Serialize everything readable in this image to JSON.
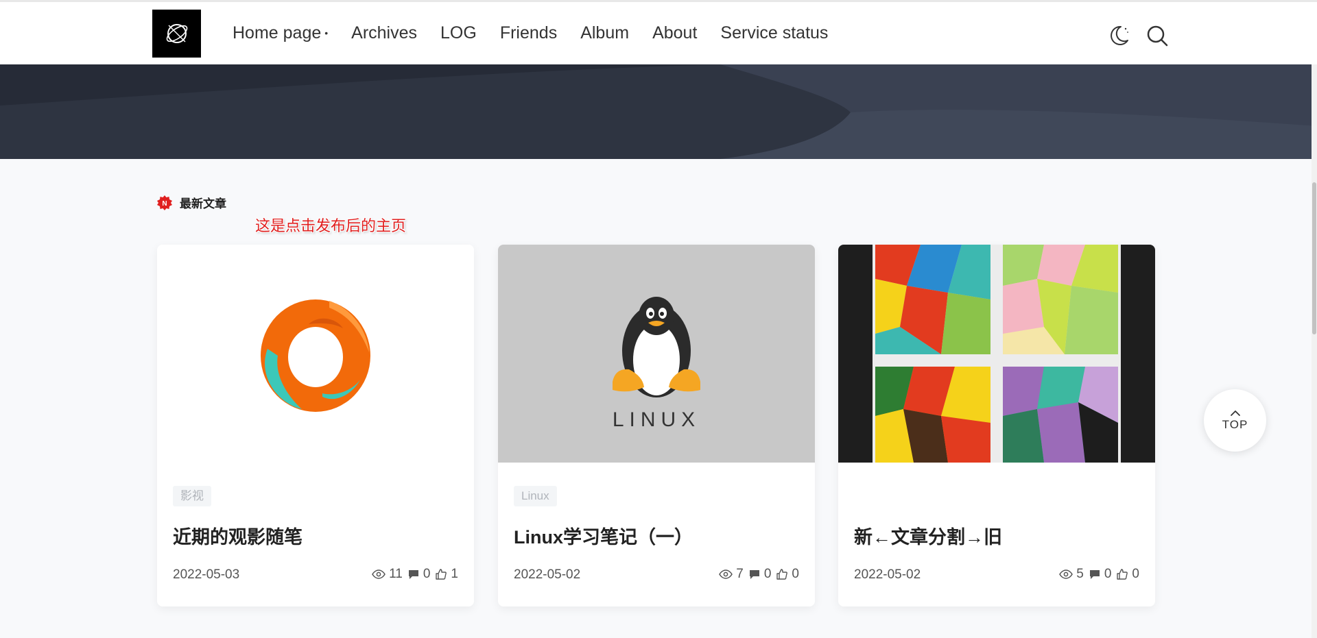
{
  "nav": {
    "items": [
      {
        "label": "Home page",
        "has_submenu": true
      },
      {
        "label": "Archives"
      },
      {
        "label": "LOG"
      },
      {
        "label": "Friends"
      },
      {
        "label": "Album"
      },
      {
        "label": "About"
      },
      {
        "label": "Service status"
      }
    ],
    "submenu_marker": "•",
    "icons": [
      "moon-icon",
      "search-icon"
    ]
  },
  "section": {
    "badge_letter": "N",
    "title": "最新文章"
  },
  "annotation": "这是点击发布后的主页",
  "cards": [
    {
      "tag": "影视",
      "title": "近期的观影随笔",
      "date": "2022-05-03",
      "views": "11",
      "comments": "0",
      "likes": "1",
      "thumb": "orange-ring-image"
    },
    {
      "tag": "Linux",
      "title": "Linux学习笔记（一）",
      "date": "2022-05-02",
      "views": "7",
      "comments": "0",
      "likes": "0",
      "thumb": "linux-penguin-image",
      "thumb_text": "LINUX"
    },
    {
      "tag": "",
      "title": "新←文章分割→旧",
      "date": "2022-05-02",
      "views": "5",
      "comments": "0",
      "likes": "0",
      "thumb": "geometric-painting-image"
    }
  ],
  "top_button": {
    "label": "TOP"
  },
  "colors": {
    "accent": "#e02020",
    "banner": "#2c313e",
    "card_bg": "#ffffff",
    "page_bg": "#f8f9fb"
  }
}
